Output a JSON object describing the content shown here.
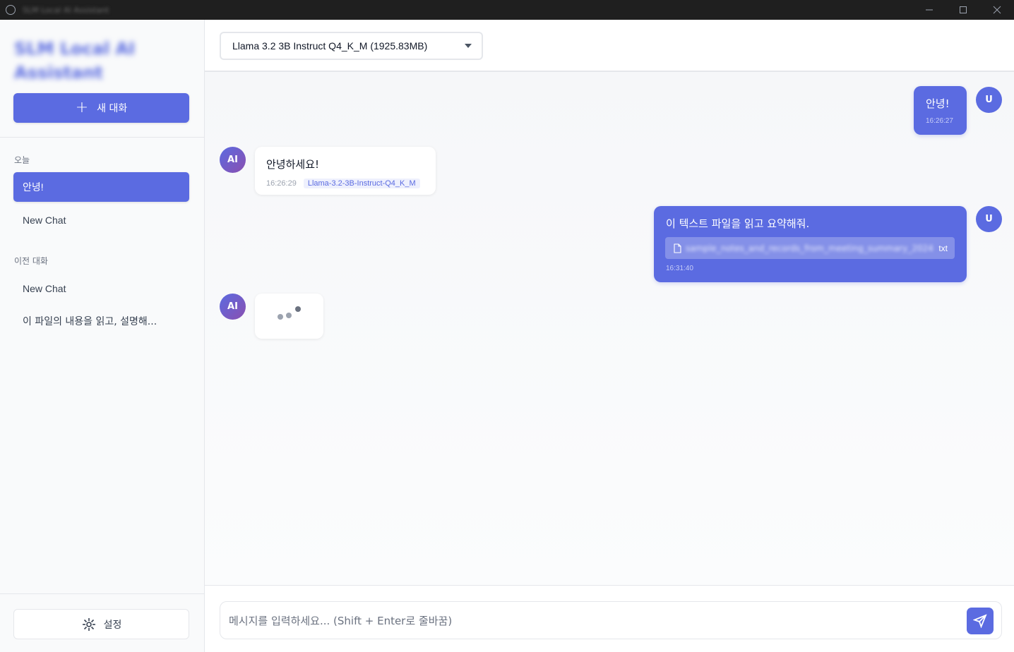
{
  "window": {
    "title": "SLM Local AI Assistant"
  },
  "sidebar": {
    "brand": "SLM Local AI Assistant",
    "new_chat_label": "새 대화",
    "section_today": "오늘",
    "today_items": [
      {
        "label": "안녕!",
        "active": true
      },
      {
        "label": "New Chat",
        "active": false
      }
    ],
    "section_previous": "이전 대화",
    "previous_items": [
      {
        "label": "New Chat"
      },
      {
        "label": "이 파일의 내용을 읽고, 설명해..."
      }
    ],
    "settings_label": "설정"
  },
  "header": {
    "model_select": {
      "selected": "Llama 3.2 3B Instruct Q4_K_M (1925.83MB)"
    }
  },
  "messages": [
    {
      "role": "user",
      "avatar": "U",
      "text": "안녕!",
      "time": "16:26:27"
    },
    {
      "role": "ai",
      "avatar": "AI",
      "text": "안녕하세요!",
      "time": "16:26:29",
      "model": "Llama-3.2-3B-Instruct-Q4_K_M"
    },
    {
      "role": "user",
      "avatar": "U",
      "text": "이 텍스트 파일을 읽고 요약해줘.",
      "time": "16:31:40",
      "attachment": {
        "name": "sample_notes_and_records_from_meeting_summary_2024",
        "ext": "txt"
      }
    },
    {
      "role": "ai",
      "avatar": "AI",
      "loading": true
    }
  ],
  "input": {
    "placeholder": "메시지를 입력하세요... (Shift + Enter로 줄바꿈)",
    "value": ""
  },
  "colors": {
    "accent": "#5b6be1",
    "ai_gradient_end": "#8a4fb0"
  }
}
